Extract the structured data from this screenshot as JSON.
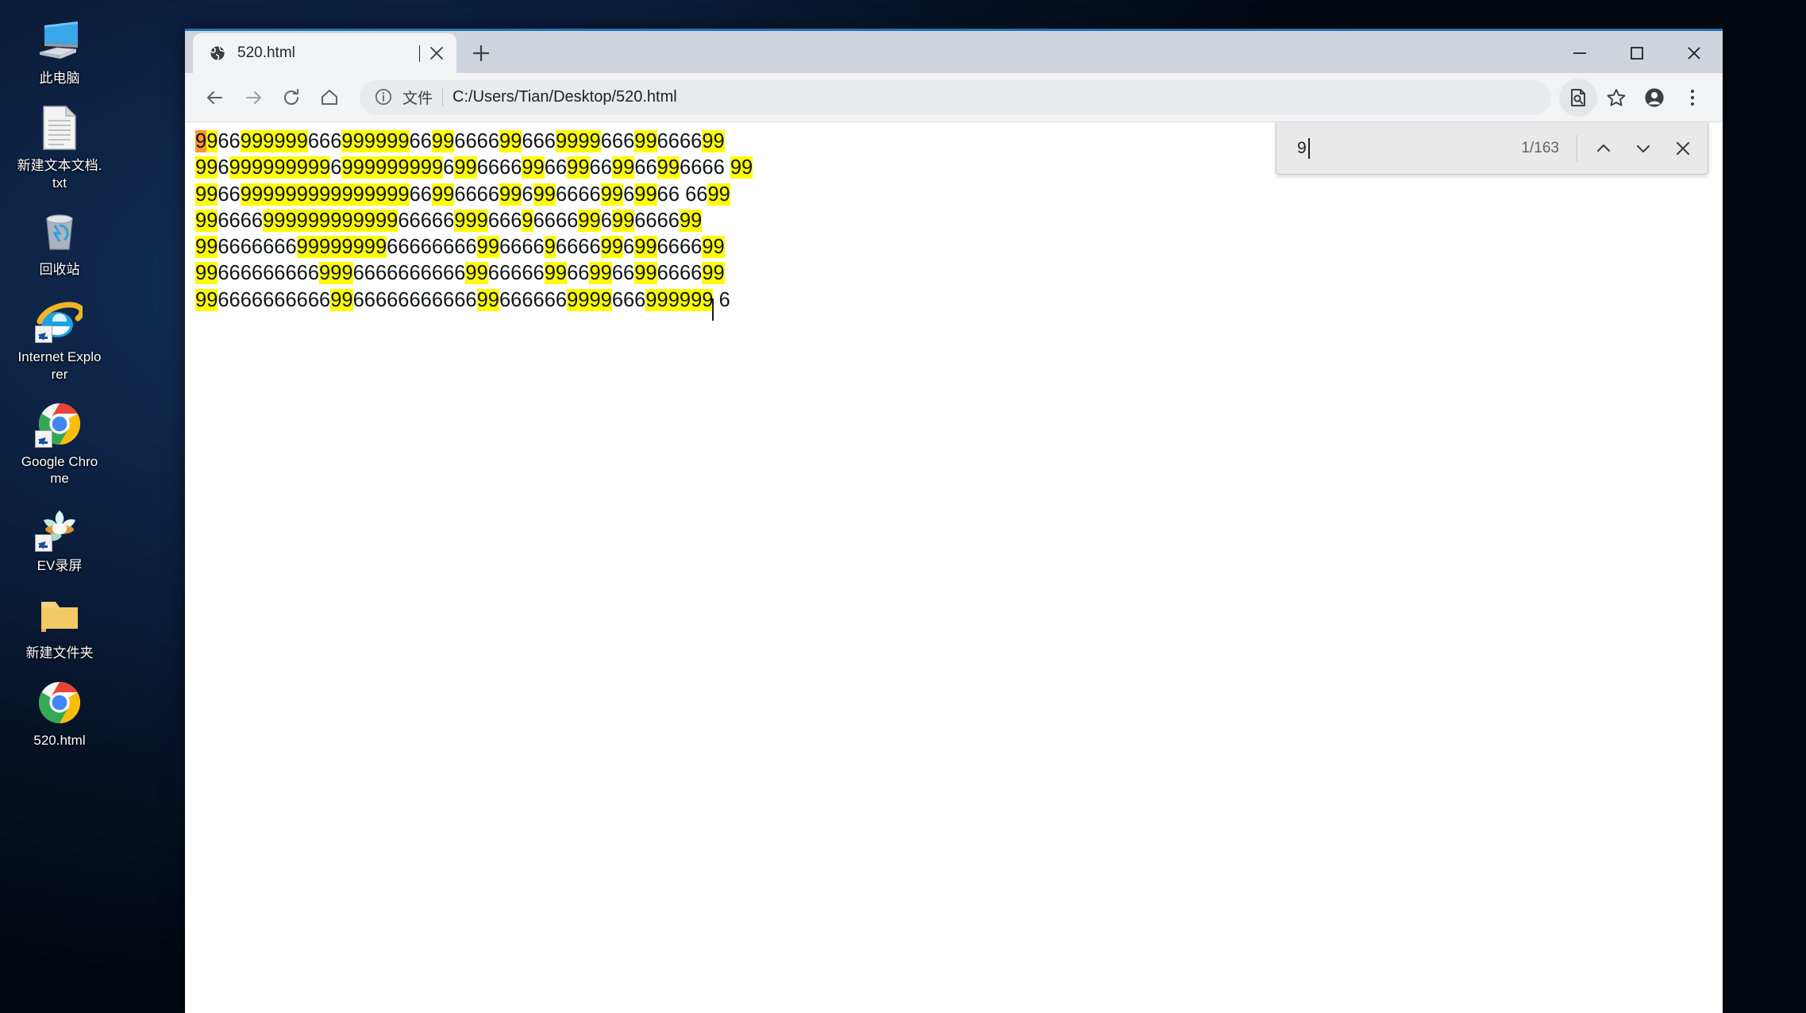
{
  "desktop": {
    "icons": [
      {
        "label": "此电脑",
        "icon": "this-pc-icon",
        "shortcut": false
      },
      {
        "label": "新建文本文档.txt",
        "icon": "text-document-icon",
        "shortcut": false
      },
      {
        "label": "回收站",
        "icon": "recycle-bin-icon",
        "shortcut": false
      },
      {
        "label": "Internet Explorer",
        "icon": "internet-explorer-icon",
        "shortcut": true
      },
      {
        "label": "Google Chrome",
        "icon": "google-chrome-icon",
        "shortcut": true
      },
      {
        "label": "EV录屏",
        "icon": "ev-recorder-icon",
        "shortcut": true
      },
      {
        "label": "新建文件夹",
        "icon": "folder-icon",
        "shortcut": false
      },
      {
        "label": "520.html",
        "icon": "google-chrome-icon",
        "shortcut": false
      }
    ]
  },
  "browser": {
    "tab": {
      "title": "520.html",
      "favicon": "globe-icon",
      "close_icon": "close-icon"
    },
    "new_tab_icon": "plus-icon",
    "window_controls": {
      "minimize": "minimize-icon",
      "maximize": "maximize-icon",
      "close": "close-icon"
    },
    "toolbar": {
      "back_icon": "back-arrow-icon",
      "forward_icon": "forward-arrow-icon",
      "reload_icon": "reload-icon",
      "home_icon": "home-icon",
      "omnibox": {
        "info_icon": "info-circle-icon",
        "scheme_label": "文件",
        "url": "C:/Users/Tian/Desktop/520.html"
      },
      "find_in_page_icon": "find-in-page-icon",
      "bookmark_icon": "star-icon",
      "profile_icon": "profile-avatar-icon",
      "menu_icon": "three-dot-menu-icon"
    },
    "findbar": {
      "query": "9",
      "match_counter": "1/163",
      "previous_icon": "chevron-up-icon",
      "next_icon": "chevron-down-icon",
      "close_icon": "close-icon"
    }
  },
  "page": {
    "highlight_color": "#ffff00",
    "active_highlight_color": "#ff9632",
    "text_color": "#111418",
    "background_color": "#ffffff",
    "highlight_char": "9",
    "lines": [
      "99669999996669999996699666699666999966699666699",
      "99699999999969999999996996666996699669966996666 99",
      "9966999999999999999669966669969966669969966 6699",
      "996666999999999999666669996669666699699666699",
      "99666666699999999666666669966669666699699666699",
      "99666666666999666666666699666669966996699666699",
      "9966666666669966666666666996666669999666999999 6"
    ]
  }
}
